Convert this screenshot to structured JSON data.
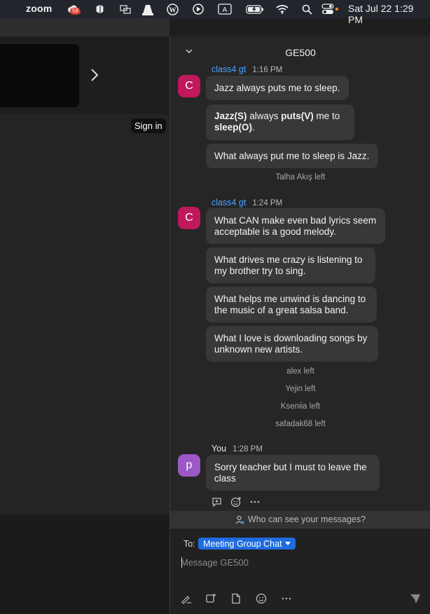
{
  "menubar": {
    "app_name": "zoom",
    "badge": "58",
    "clock": "Sat Jul 22  1:29 PM",
    "icons": [
      "adobe-creative-cloud-icon",
      "box-icon",
      "screens-icon",
      "vlc-icon",
      "wordpress-icon",
      "play-icon",
      "input-source-icon",
      "battery-icon",
      "wifi-icon",
      "search-icon",
      "control-center-icon"
    ]
  },
  "left": {
    "sign_in_label": "Sign in"
  },
  "chat": {
    "title": "GE500",
    "groups": [
      {
        "sender": "class4 gt",
        "time": "1:16 PM",
        "avatar_letter": "C",
        "avatar_color": "#c0185a",
        "messages": [
          {
            "text": "Jazz always puts me to sleep."
          },
          {
            "parts": [
              {
                "t": "Jazz(S)",
                "b": true
              },
              {
                "t": " always ",
                "b": false
              },
              {
                "t": "puts(V)",
                "b": true
              },
              {
                "t": " me to ",
                "b": false
              },
              {
                "t": "sleep(O)",
                "b": true
              },
              {
                "t": ".",
                "b": false
              }
            ]
          },
          {
            "text": "What always put me to sleep is Jazz."
          }
        ]
      },
      {
        "sender": "class4 gt",
        "time": "1:24 PM",
        "avatar_letter": "C",
        "avatar_color": "#c0185a",
        "messages": [
          {
            "text": "What CAN make even bad lyrics seem acceptable is a good melody."
          },
          {
            "text": "What drives me crazy is listening to my brother try to sing."
          },
          {
            "text": "What helps me unwind is dancing to the music of a great salsa band."
          },
          {
            "text": "What I love is downloading songs by unknown new artists."
          }
        ]
      },
      {
        "sender": "You",
        "time": "1:28 PM",
        "avatar_letter": "p",
        "avatar_color": "#9b59c7",
        "messages": [
          {
            "text": "Sorry teacher but I must to leave the class"
          }
        ]
      }
    ],
    "system_messages": [
      "Talha Akış left",
      "alex left",
      "Yejin left",
      "Kseniia left",
      "safadak68 left"
    ],
    "visibility_text": "Who can see your messages?",
    "composer": {
      "to_label": "To:",
      "recipient": "Meeting Group Chat",
      "placeholder": "Message GE500"
    }
  }
}
